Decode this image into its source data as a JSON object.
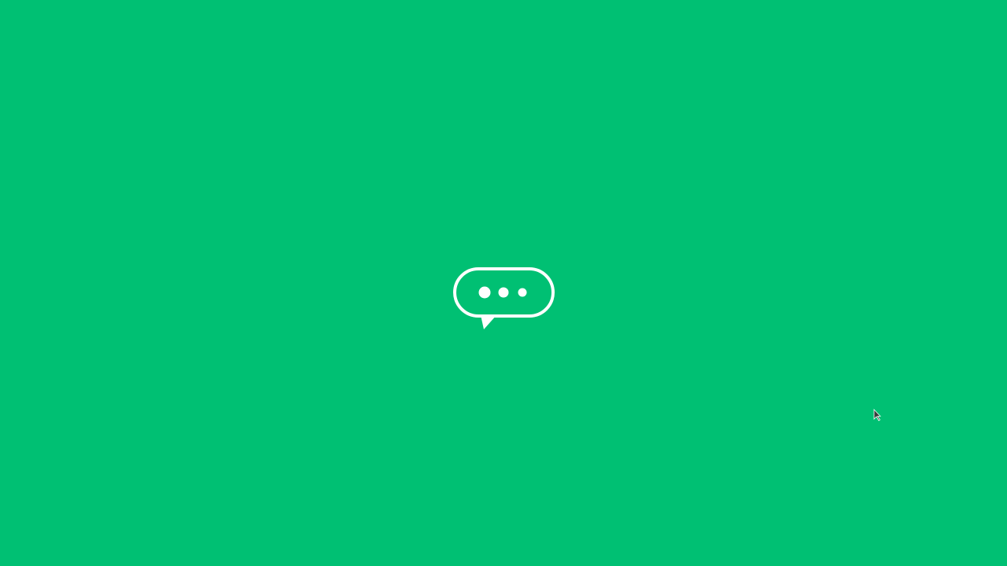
{
  "screen": {
    "background_color": "#00C073",
    "foreground_color": "#FFFFFF",
    "cursor_color": "#3A3A3A"
  },
  "splash": {
    "icon": "chat-bubble-ellipsis-icon"
  }
}
